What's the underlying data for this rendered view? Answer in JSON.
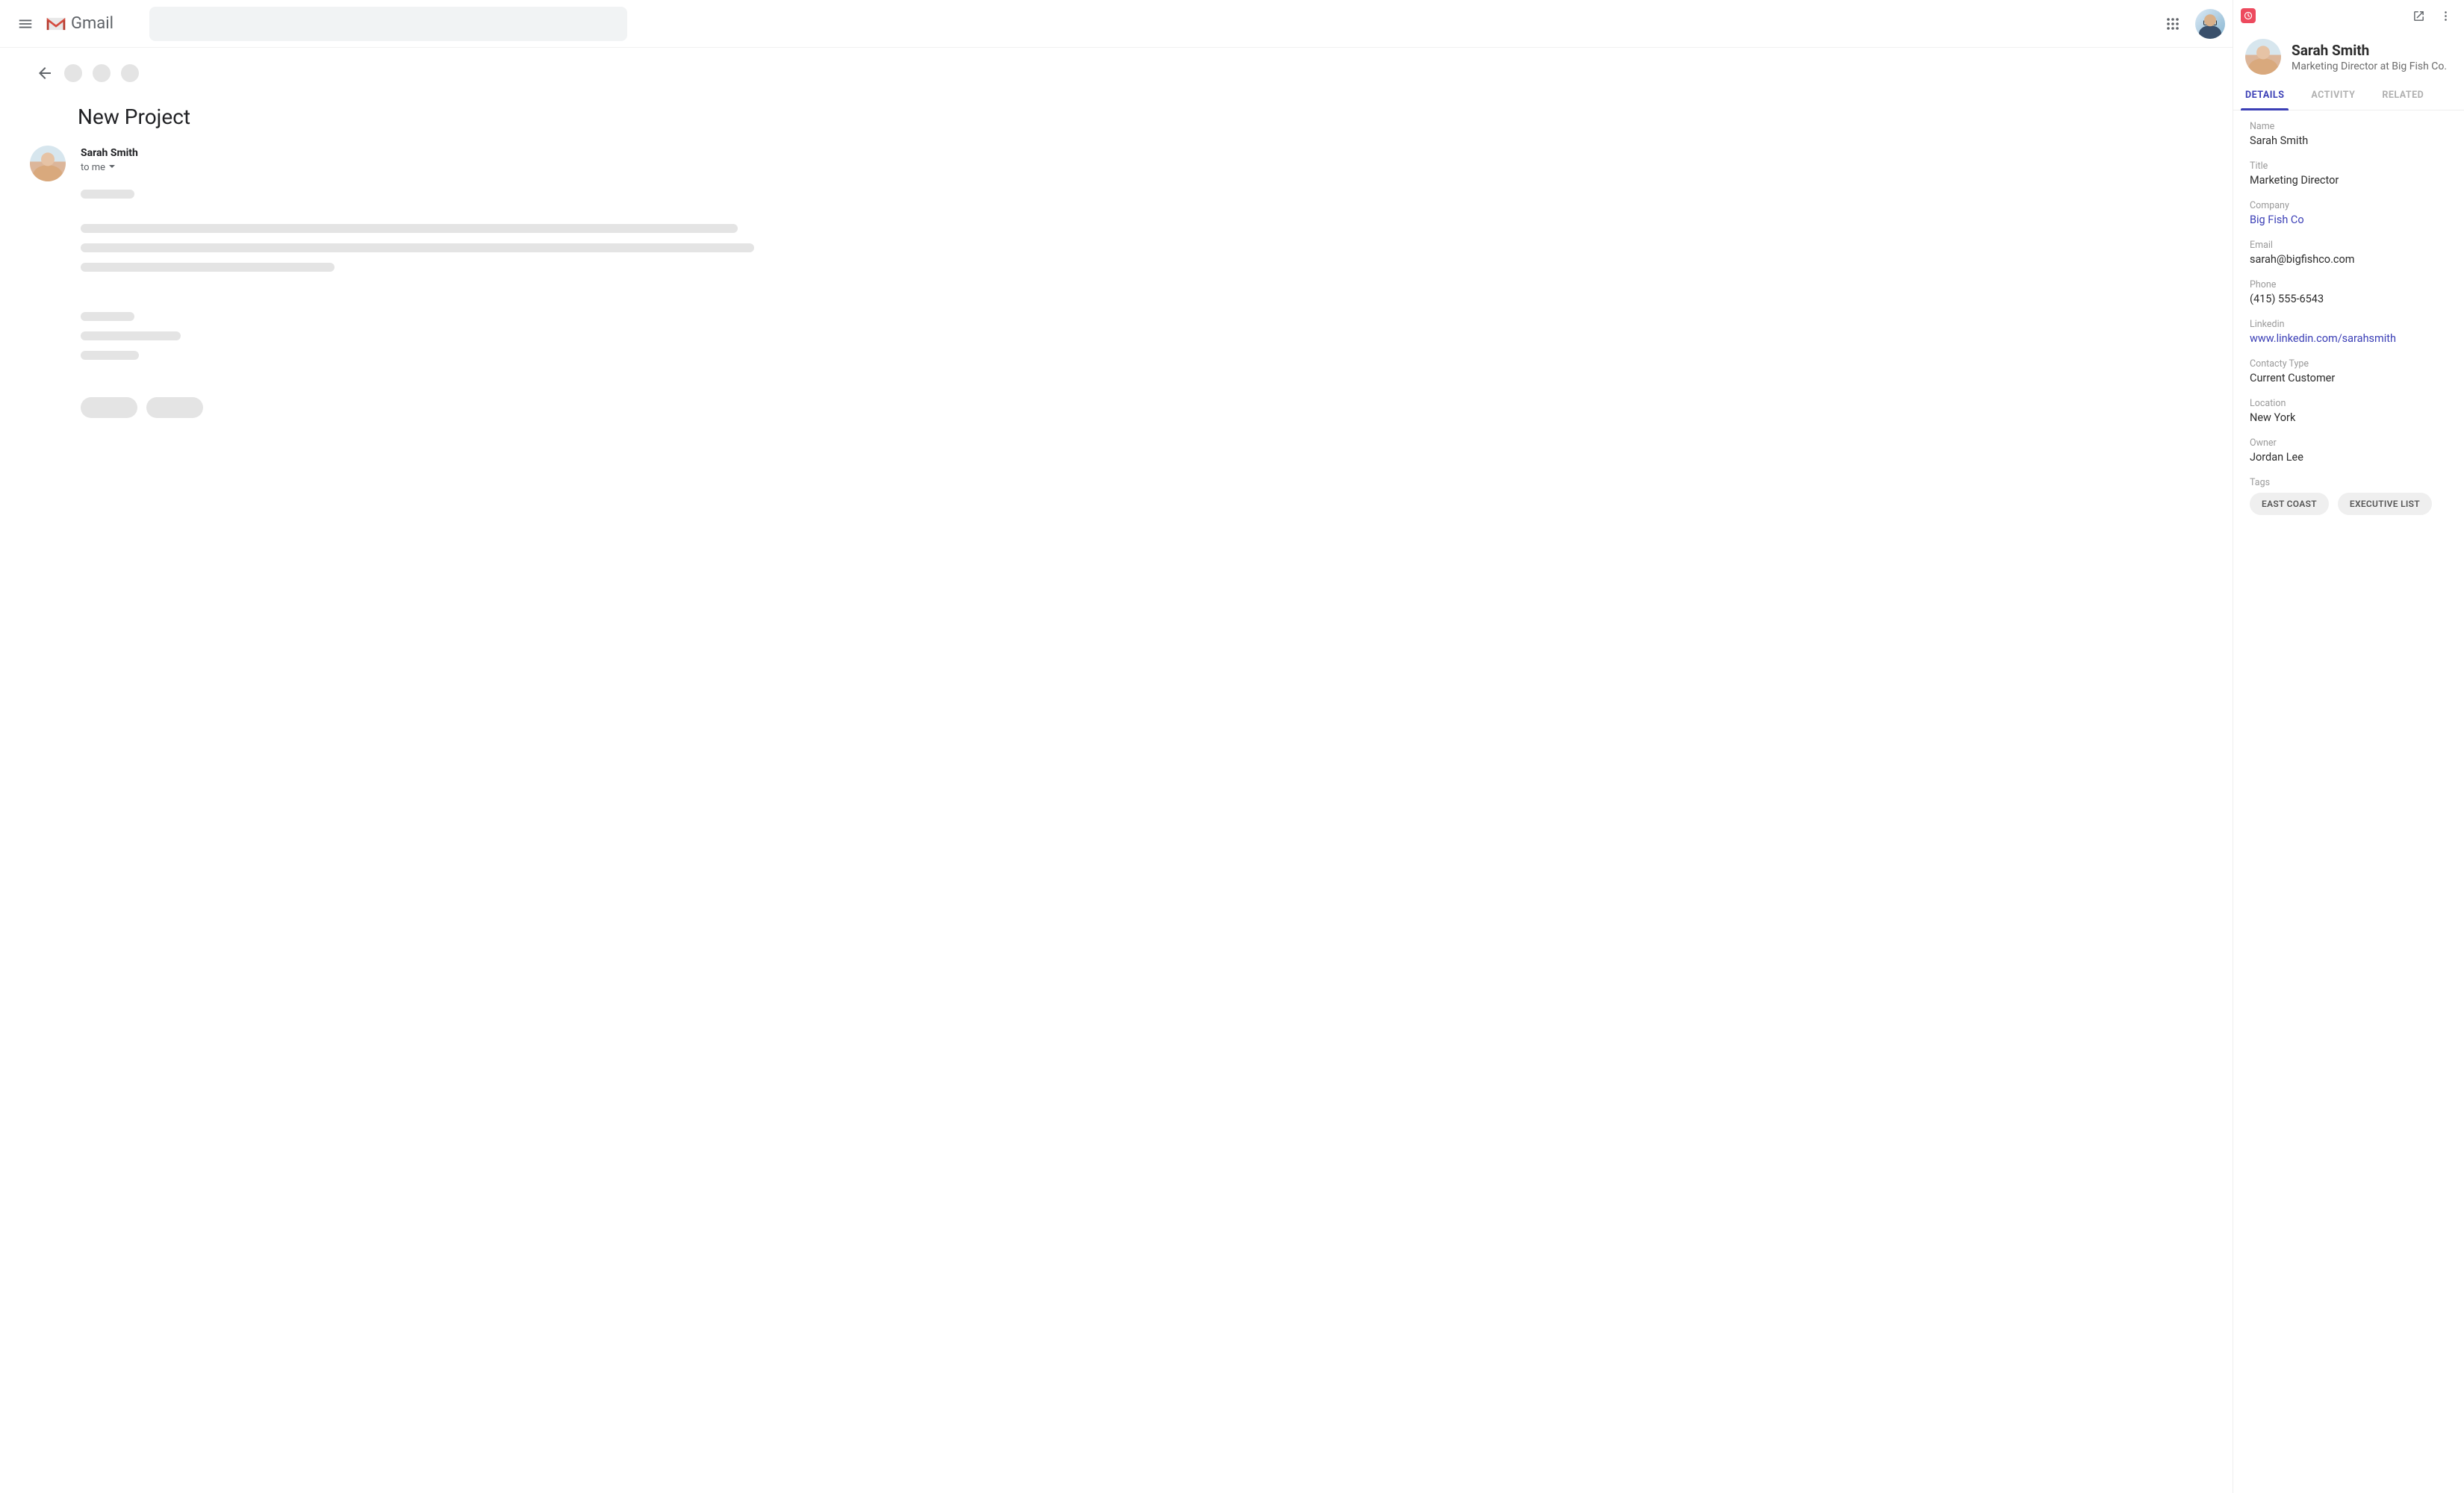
{
  "header": {
    "app_name": "Gmail"
  },
  "email": {
    "subject": "New Project",
    "sender": "Sarah Smith",
    "to_line": "to me"
  },
  "panel": {
    "contact": {
      "name": "Sarah Smith",
      "subtitle": "Marketing Director at Big Fish Co."
    },
    "tabs": {
      "details": "DETAILS",
      "activity": "ACTIVITY",
      "related": "RELATED"
    },
    "fields": {
      "name": {
        "label": "Name",
        "value": "Sarah Smith"
      },
      "title": {
        "label": "Title",
        "value": "Marketing Director"
      },
      "company": {
        "label": "Company",
        "value": "Big Fish Co"
      },
      "email": {
        "label": "Email",
        "value": "sarah@bigfishco.com"
      },
      "phone": {
        "label": "Phone",
        "value": "(415) 555-6543"
      },
      "linkedin": {
        "label": "Linkedin",
        "value": "www.linkedin.com/sarahsmith"
      },
      "contact_type": {
        "label": "Contacty Type",
        "value": "Current Customer"
      },
      "location": {
        "label": "Location",
        "value": "New York"
      },
      "owner": {
        "label": "Owner",
        "value": "Jordan Lee"
      },
      "tags": {
        "label": "Tags",
        "values": [
          "EAST COAST",
          "EXECUTIVE LIST"
        ]
      }
    }
  }
}
